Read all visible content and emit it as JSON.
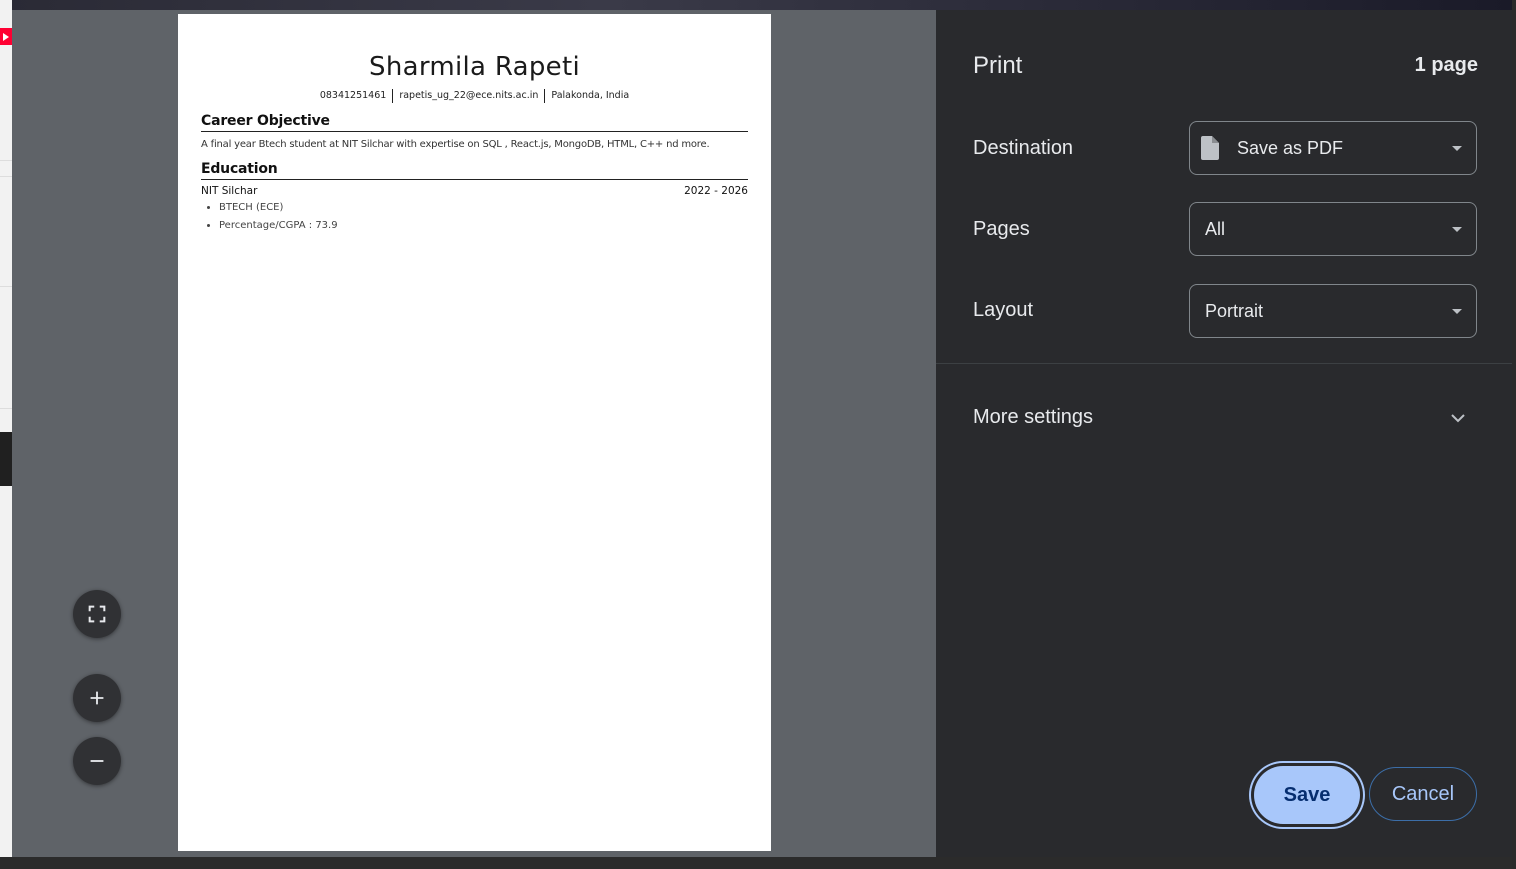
{
  "document": {
    "name": "Sharmila Rapeti",
    "contact": [
      "08341251461",
      "rapetis_ug_22@ece.nits.ac.in",
      "Palakonda, India"
    ],
    "sections": {
      "objective_title": "Career Objective",
      "objective_text": "A final year Btech student at NIT Silchar with expertise on SQL , React.js, MongoDB, HTML, C++ nd more.",
      "education_title": "Education",
      "institution": "NIT Silchar",
      "years": "2022 - 2026",
      "details": [
        "BTECH (ECE)",
        "Percentage/CGPA : 73.9"
      ]
    }
  },
  "preview_controls": {
    "fit_icon": "fit-to-page-icon",
    "zoom_in_icon": "plus-icon",
    "zoom_out_icon": "minus-icon"
  },
  "print_panel": {
    "title": "Print",
    "page_count": "1 page",
    "destination_label": "Destination",
    "destination_value": "Save as PDF",
    "pages_label": "Pages",
    "pages_value": "All",
    "layout_label": "Layout",
    "layout_value": "Portrait",
    "more_settings": "More settings",
    "save_button": "Save",
    "cancel_button": "Cancel"
  },
  "colors": {
    "panel_bg": "#292a2d",
    "preview_bg": "#5f6368",
    "accent": "#a8c7fa"
  }
}
